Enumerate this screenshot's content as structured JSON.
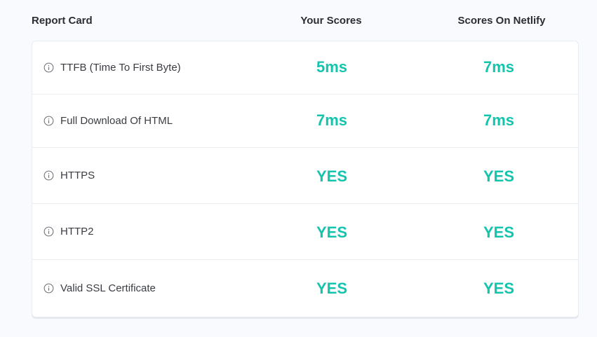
{
  "header": {
    "title": "Report Card",
    "col_your": "Your Scores",
    "col_netlify": "Scores On Netlify"
  },
  "colors": {
    "accent": "#14c4ad",
    "background": "#f9fafd",
    "card": "#ffffff"
  },
  "rows": [
    {
      "icon": "info-icon",
      "label": "TTFB (Time To First Byte)",
      "your": "5ms",
      "netlify": "7ms"
    },
    {
      "icon": "info-icon",
      "label": "Full Download Of HTML",
      "your": "7ms",
      "netlify": "7ms"
    },
    {
      "icon": "info-icon",
      "label": "HTTPS",
      "your": "YES",
      "netlify": "YES"
    },
    {
      "icon": "info-icon",
      "label": "HTTP2",
      "your": "YES",
      "netlify": "YES"
    },
    {
      "icon": "info-icon",
      "label": "Valid SSL Certificate",
      "your": "YES",
      "netlify": "YES"
    }
  ]
}
